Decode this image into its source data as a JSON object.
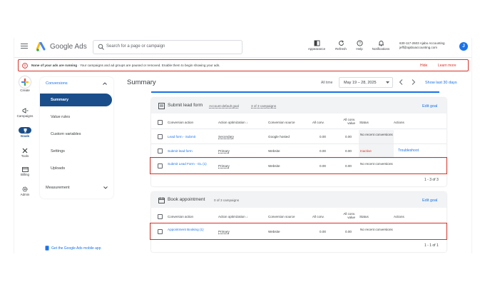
{
  "header": {
    "brand": "Google Ads",
    "search_placeholder": "Search for a page or campaign",
    "tools": [
      {
        "icon": "appearance-icon",
        "label": "Appearance"
      },
      {
        "icon": "refresh-icon",
        "label": "Refresh"
      },
      {
        "icon": "help-icon",
        "label": "Help"
      },
      {
        "icon": "notifications-icon",
        "label": "Notifications"
      }
    ],
    "account_id": "630-117-2603 Ajabo Accounting",
    "account_email": "jeff@ajaboaccounting.com",
    "avatar_letter": "J"
  },
  "alert": {
    "bold": "None of your ads are running",
    "text": " · Your campaigns and ad groups are paused or removed. Enable them to begin showing your ads.",
    "hide": "Hide",
    "learn_more": "Learn more"
  },
  "rail": {
    "create": "Create",
    "campaigns": "Campaigns",
    "goals": "Goals",
    "tools": "Tools",
    "billing": "Billing",
    "admin": "Admin"
  },
  "sidenav": {
    "section": "Conversions",
    "items": [
      "Summary",
      "Value rules",
      "Custom variables",
      "Settings",
      "Uploads"
    ],
    "measurement": "Measurement",
    "mobile_app": "Get the Google Ads mobile app"
  },
  "main": {
    "title": "Summary",
    "all_time": "All time",
    "date_range": "May 19 – 28, 2025",
    "show_last": "Show last 30 days"
  },
  "columns": {
    "action": "Conversion action",
    "optimization": "Action optimization",
    "source": "Conversion source",
    "all_conv": "All conv.",
    "all_conv_value": "All conv. value",
    "status": "Status",
    "actions": "Actions"
  },
  "card1": {
    "title": "Submit lead form",
    "goal_type": "Account-default goal",
    "campaigns": "3 of 3 campaigns",
    "edit": "Edit goal",
    "rows": [
      {
        "name": "Lead form - Submit",
        "optimization": "Secondary",
        "source": "Google hosted",
        "conv": "0.00",
        "value": "0.00",
        "status": "No recent conversions",
        "action": ""
      },
      {
        "name": "Submit lead form",
        "optimization": "Primary",
        "source": "Website",
        "conv": "0.00",
        "value": "0.00",
        "status": "Inactive",
        "action": "Troubleshoot"
      },
      {
        "name": "Submit Lead Form - GL (1)",
        "optimization": "Primary",
        "source": "Website",
        "conv": "0.00",
        "value": "0.00",
        "status": "No recent conversions",
        "action": ""
      }
    ],
    "pager": "1 - 3 of 3"
  },
  "card2": {
    "title": "Book appointment",
    "campaigns": "0 of 3 campaigns",
    "edit": "Edit goal",
    "rows": [
      {
        "name": "Appointment Booking (1)",
        "optimization": "Primary",
        "source": "Website",
        "conv": "0.00",
        "value": "0.00",
        "status": "No recent conversions",
        "action": ""
      }
    ],
    "pager": "1 - 1 of 1"
  },
  "colors": {
    "accent": "#1a73e8",
    "nav_active": "#1a4e8a",
    "alert": "#d93025"
  }
}
